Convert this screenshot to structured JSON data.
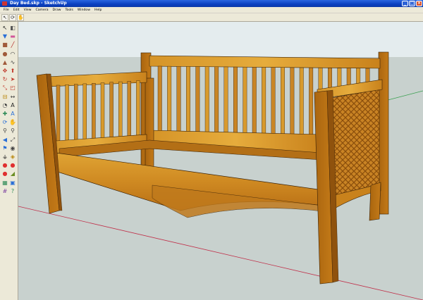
{
  "window": {
    "title": "Day Bed.skp - SketchUp",
    "controls": {
      "minimize": "_",
      "maximize": "□",
      "close": "×"
    }
  },
  "menu": {
    "items": [
      "File",
      "Edit",
      "View",
      "Camera",
      "Draw",
      "Tools",
      "Window",
      "Help"
    ]
  },
  "top_toolbar": [
    {
      "icon": "select-arrow-icon",
      "glyph": "↖"
    },
    {
      "icon": "orbit-icon",
      "glyph": "⟳"
    },
    {
      "icon": "pan-icon",
      "glyph": "✋"
    }
  ],
  "left_toolbar": [
    {
      "icon": "select-icon",
      "glyph": "↖",
      "color": "#222222"
    },
    {
      "icon": "make-component-icon",
      "glyph": "◧",
      "color": "#555555"
    },
    {
      "icon": "paint-bucket-icon",
      "glyph": "▼",
      "color": "#2a6fd6"
    },
    {
      "icon": "eraser-icon",
      "glyph": "▬",
      "color": "#d1579a"
    },
    {
      "icon": "rectangle-icon",
      "glyph": "■",
      "color": "#a05a3a"
    },
    {
      "icon": "line-icon",
      "glyph": "╱",
      "color": "#b22222"
    },
    {
      "icon": "circle-icon",
      "glyph": "●",
      "color": "#a05a3a"
    },
    {
      "icon": "arc-icon",
      "glyph": "◠",
      "color": "#444444"
    },
    {
      "icon": "polygon-icon",
      "glyph": "▲",
      "color": "#a05a3a"
    },
    {
      "icon": "freehand-icon",
      "glyph": "∿",
      "color": "#444444"
    },
    {
      "icon": "move-icon",
      "glyph": "✥",
      "color": "#c0392b"
    },
    {
      "icon": "push-pull-icon",
      "glyph": "⬆",
      "color": "#c0392b"
    },
    {
      "icon": "rotate-icon",
      "glyph": "↻",
      "color": "#c0392b"
    },
    {
      "icon": "follow-me-icon",
      "glyph": "➤",
      "color": "#c0392b"
    },
    {
      "icon": "scale-icon",
      "glyph": "⤡",
      "color": "#c0392b"
    },
    {
      "icon": "offset-icon",
      "glyph": "◰",
      "color": "#c0392b"
    },
    {
      "icon": "tape-measure-icon",
      "glyph": "⊟",
      "color": "#b8860b"
    },
    {
      "icon": "dimension-icon",
      "glyph": "↔",
      "color": "#444444"
    },
    {
      "icon": "protractor-icon",
      "glyph": "◔",
      "color": "#444444"
    },
    {
      "icon": "text-icon",
      "glyph": "A",
      "color": "#222222"
    },
    {
      "icon": "axes-icon",
      "glyph": "✚",
      "color": "#2e8b57"
    },
    {
      "icon": "3d-text-icon",
      "glyph": "A",
      "color": "#2a6fd6"
    },
    {
      "icon": "orbit-icon",
      "glyph": "⟳",
      "color": "#2a6fd6"
    },
    {
      "icon": "pan-icon",
      "glyph": "✋",
      "color": "#b8860b"
    },
    {
      "icon": "zoom-icon",
      "glyph": "⚲",
      "color": "#444444"
    },
    {
      "icon": "zoom-window-icon",
      "glyph": "⚲",
      "color": "#444444"
    },
    {
      "icon": "previous-view-icon",
      "glyph": "◀",
      "color": "#2a6fd6"
    },
    {
      "icon": "zoom-extents-icon",
      "glyph": "⤢",
      "color": "#444444"
    },
    {
      "icon": "position-camera-icon",
      "glyph": "⚑",
      "color": "#2a6fd6"
    },
    {
      "icon": "look-around-icon",
      "glyph": "◉",
      "color": "#444444"
    },
    {
      "icon": "walk-icon",
      "glyph": "⚶",
      "color": "#222222"
    },
    {
      "icon": "section-plane-icon",
      "glyph": "◈",
      "color": "#b8860b"
    },
    {
      "icon": "stop-icon",
      "glyph": "●",
      "color": "#e03030"
    },
    {
      "icon": "record-icon",
      "glyph": "●",
      "color": "#e03030"
    },
    {
      "icon": "stop-alt-icon",
      "glyph": "●",
      "color": "#e03030"
    },
    {
      "icon": "sandbox-icon",
      "glyph": "◢",
      "color": "#6b8e23"
    },
    {
      "icon": "terrain-icon",
      "glyph": "▦",
      "color": "#2e8b57"
    },
    {
      "icon": "photo-match-icon",
      "glyph": "▣",
      "color": "#2a6fd6"
    },
    {
      "icon": "grid-icon",
      "glyph": "#",
      "color": "#7b3fa0"
    },
    {
      "icon": "help-icon",
      "glyph": "?",
      "color": "#2e8b57"
    }
  ],
  "colors": {
    "sky": "#d6e2e4",
    "ground": "#c5cdc9",
    "wood_light": "#d99a2b",
    "wood_mid": "#c47a18",
    "wood_dark": "#9a5a10",
    "edge": "#3a2208",
    "axis_red": "#c0304a",
    "axis_green": "#3aa050"
  }
}
